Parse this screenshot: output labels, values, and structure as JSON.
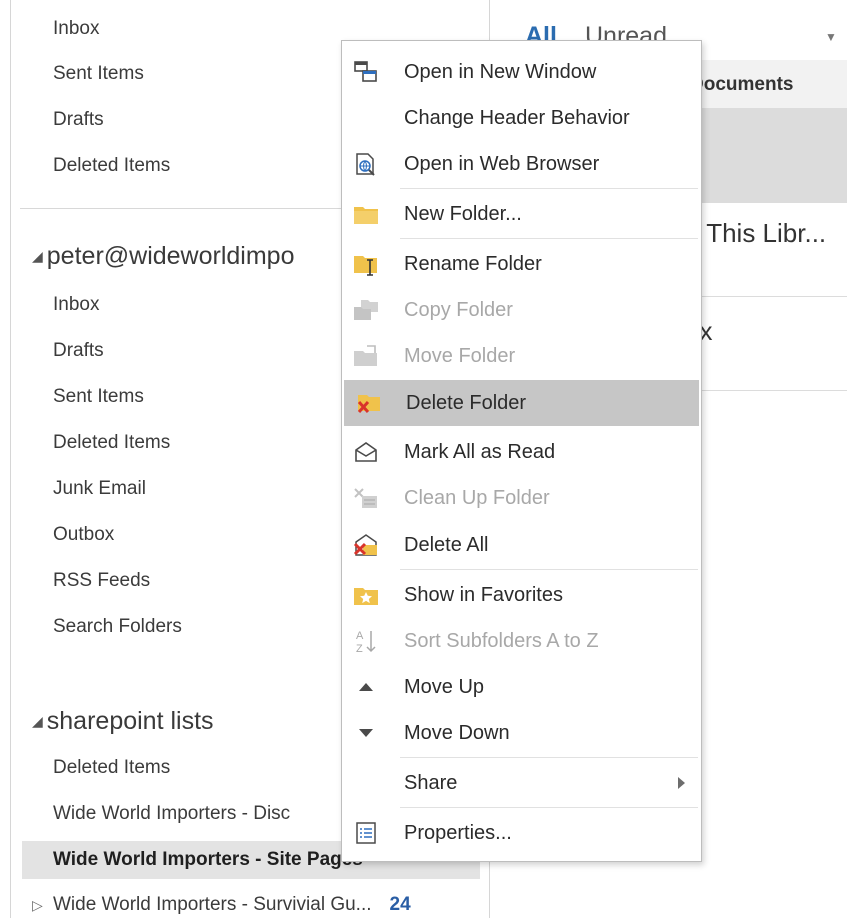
{
  "folder_pane": {
    "top_folders": [
      "Inbox",
      "Sent Items",
      "Drafts",
      "Deleted Items"
    ],
    "account1": {
      "name": "peter@wideworldimpo",
      "folders": [
        "Inbox",
        "Drafts",
        "Sent Items",
        "Deleted Items",
        "Junk Email",
        "Outbox",
        "RSS Feeds",
        "Search Folders"
      ]
    },
    "account2": {
      "name": "sharepoint lists",
      "folders": [
        "Deleted Items",
        "Wide World Importers - Disc",
        "Wide World Importers - Site Pages",
        "Wide World Importers - Survivial Gu..."
      ],
      "unread_count": "24"
    }
  },
  "message_list": {
    "filter_all": "All",
    "filter_unread": "Unread",
    "column_header": "Documents",
    "row1_text": "e This Libr...",
    "row2_text": "px"
  },
  "context_menu": {
    "items": [
      {
        "label": "Open in New Window",
        "icon": "new-window-icon",
        "enabled": true
      },
      {
        "label": "Change Header Behavior",
        "icon": "",
        "enabled": true
      },
      {
        "label": "Open in Web Browser",
        "icon": "web-browser-icon",
        "enabled": true
      },
      {
        "label": "New Folder...",
        "icon": "folder-icon",
        "enabled": true
      },
      {
        "label": "Rename Folder",
        "icon": "rename-folder-icon",
        "enabled": true
      },
      {
        "label": "Copy Folder",
        "icon": "copy-folder-icon",
        "enabled": false
      },
      {
        "label": "Move Folder",
        "icon": "move-folder-icon",
        "enabled": false
      },
      {
        "label": "Delete Folder",
        "icon": "delete-folder-icon",
        "enabled": true,
        "highlighted": true
      },
      {
        "label": "Mark All as Read",
        "icon": "mark-read-icon",
        "enabled": true
      },
      {
        "label": "Clean Up Folder",
        "icon": "clean-up-icon",
        "enabled": false
      },
      {
        "label": "Delete All",
        "icon": "delete-all-icon",
        "enabled": true
      },
      {
        "label": "Show in Favorites",
        "icon": "favorites-icon",
        "enabled": true
      },
      {
        "label": "Sort Subfolders A to Z",
        "icon": "sort-az-icon",
        "enabled": false
      },
      {
        "label": "Move Up",
        "icon": "move-up-icon",
        "enabled": true
      },
      {
        "label": "Move Down",
        "icon": "move-down-icon",
        "enabled": true
      },
      {
        "label": "Share",
        "icon": "",
        "enabled": true,
        "submenu": true
      },
      {
        "label": "Properties...",
        "icon": "properties-icon",
        "enabled": true
      }
    ]
  },
  "colors": {
    "accent_blue": "#2b6cb0",
    "highlight_gray": "#c6c6c6",
    "folder_yellow": "#f0c24b",
    "delete_red": "#d9342b"
  }
}
